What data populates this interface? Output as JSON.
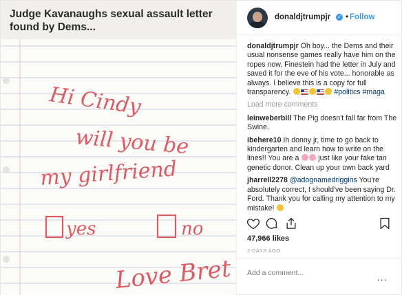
{
  "media": {
    "headline": "Judge Kavanaughs sexual assault letter found by Dems...",
    "letter": {
      "line1": "Hi Cindy",
      "line2": "will you be",
      "line3": "my girlfriend",
      "opt_yes": "yes",
      "opt_no": "no",
      "signoff": "Love Bret"
    }
  },
  "header": {
    "username": "donaldjtrumpjr",
    "separator": "•",
    "follow_label": "Follow",
    "verified_glyph": "✓"
  },
  "comments": [
    {
      "user": "donaldjtrumpjr",
      "text": "Oh boy... the Dems and their usual nonsense games really have him on the ropes now. Finestein had the letter in July and saved it for the eve of his vote... honorable as always. I believe this is a copy for full transparency.",
      "tags": "#politics #maga"
    },
    {
      "user": "leinweberbill",
      "text": "The Pig doesn't fall far from The Swine."
    },
    {
      "user": "ibehere10",
      "text": "Ih donny jr, time to go back to kindergarten and learn how to write on the lines!! You are a",
      "text2": "just like your fake tan genetic donor. Clean up your own back yard"
    },
    {
      "user": "jharrell2278",
      "mention": "@adognamedriggins",
      "text": "You're absolutely correct, I should've been saying Dr. Ford. Thank you for calling my attention to my mistake!"
    }
  ],
  "load_more": "Load more comments",
  "likes": "47,966 likes",
  "time_ago": "2 DAYS AGO",
  "add_comment_placeholder": "Add a comment...",
  "more_options": "...",
  "colors": {
    "link": "#3897f0",
    "ink": "#e05a63",
    "tag": "#003569"
  },
  "icons": [
    "heart-icon",
    "comment-icon",
    "share-icon",
    "bookmark-icon",
    "verified-icon"
  ]
}
